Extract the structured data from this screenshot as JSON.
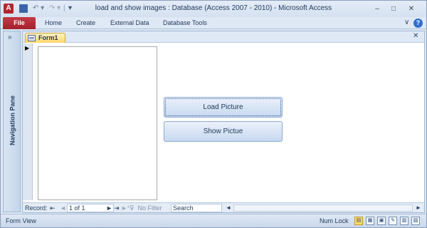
{
  "titlebar": {
    "app_icon": "A",
    "title": "load and show images : Database (Access 2007 - 2010)  -  Microsoft Access",
    "qat": [
      "save-icon",
      "undo-icon",
      "redo-icon",
      "customize-icon"
    ],
    "controls": {
      "minimize": "–",
      "maximize": "□",
      "close": "✕"
    }
  },
  "ribbon": {
    "file_tab": "File",
    "tabs": [
      "Home",
      "Create",
      "External Data",
      "Database Tools"
    ],
    "collapse_glyph": "∨",
    "help_glyph": "?"
  },
  "nav_pane": {
    "toggle": "»",
    "label": "Navigation Pane"
  },
  "document": {
    "tab_label": "Form1",
    "close_glyph": "✕",
    "record_selector": "▶"
  },
  "form": {
    "load_button": "Load Picture",
    "show_button": "Show Pictue"
  },
  "record_nav": {
    "label": "Record:",
    "first": "⇤",
    "prev": "◄",
    "position": "1 of 1",
    "next": "►",
    "last": "⇥",
    "new": "►*",
    "filter_label": "No Filter",
    "search_placeholder": "Search",
    "scroll_left": "◄",
    "scroll_right": "►"
  },
  "statusbar": {
    "view": "Form View",
    "numlock": "Num Lock",
    "view_buttons": [
      "form-view-icon",
      "datasheet-view-icon",
      "layout-view-icon",
      "design-view-icon",
      "pivottable-view-icon",
      "pivotchart-view-icon"
    ]
  },
  "colors": {
    "accent": "#b3262e",
    "active_tab": "#fbd868",
    "window": "#dfe9f5"
  }
}
